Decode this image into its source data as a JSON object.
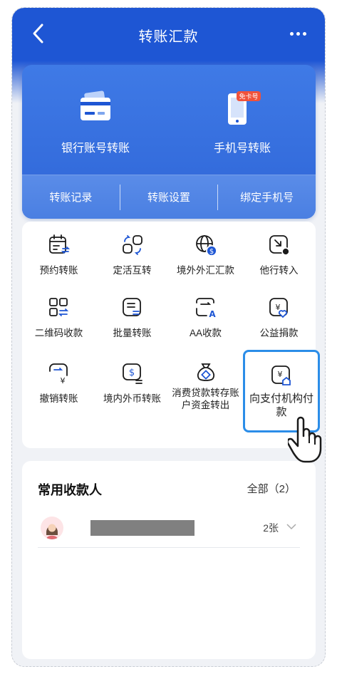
{
  "header": {
    "title": "转账汇款"
  },
  "hero": {
    "bank_transfer": "银行账号转账",
    "phone_transfer": "手机号转账",
    "phone_badge": "免卡号",
    "links": [
      "转账记录",
      "转账设置",
      "绑定手机号"
    ]
  },
  "grid": {
    "items": [
      {
        "label": "预约转账",
        "icon": "calendar-transfer-icon"
      },
      {
        "label": "定活互转",
        "icon": "deposit-switch-icon"
      },
      {
        "label": "境外外汇汇款",
        "icon": "globe-dollar-icon"
      },
      {
        "label": "他行转入",
        "icon": "transfer-in-icon"
      },
      {
        "label": "二维码收款",
        "icon": "qr-code-icon"
      },
      {
        "label": "批量转账",
        "icon": "batch-transfer-icon"
      },
      {
        "label": "AA收款",
        "icon": "aa-collect-icon"
      },
      {
        "label": "公益捐款",
        "icon": "charity-heart-icon"
      },
      {
        "label": "撤销转账",
        "icon": "cancel-transfer-icon"
      },
      {
        "label": "境内外币转账",
        "icon": "foreign-currency-icon"
      },
      {
        "label": "消费贷款转存账户资金转出",
        "icon": "loan-bag-icon"
      },
      {
        "label": "向支付机构付款",
        "icon": "pay-institution-icon"
      }
    ]
  },
  "payees": {
    "title": "常用收款人",
    "all_label": "全部（2）",
    "rows": [
      {
        "cards": "2张"
      }
    ]
  },
  "colors": {
    "primary": "#1e56d4",
    "highlight": "#2b8de8",
    "badge": "#f0523b"
  }
}
